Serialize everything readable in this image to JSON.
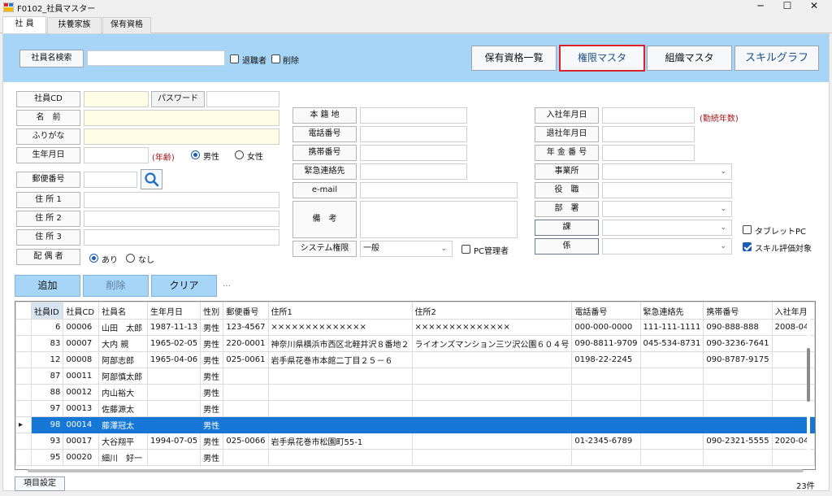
{
  "window": {
    "title": "F0102_社員マスター",
    "minimize": "─",
    "maximize": "☐",
    "close": "✕"
  },
  "tabs": [
    "社 員",
    "扶養家族",
    "保有資格"
  ],
  "search": {
    "button": "社員名検索",
    "value": "",
    "retired_label": "退職者",
    "deleted_label": "削除",
    "retired_checked": false,
    "deleted_checked": false
  },
  "top_buttons": {
    "qualifications": "保有資格一覧",
    "permission": "権限マスタ",
    "organization": "組織マスタ",
    "skill_graph": "スキルグラフ"
  },
  "form": {
    "employee_cd_label": "社員CD",
    "password_label": "パスワード",
    "name_label": "名　前",
    "furigana_label": "ふりがな",
    "birth_label": "生年月日",
    "age_text": "(年齢)",
    "gender": {
      "male": "男性",
      "female": "女性",
      "selected": "male"
    },
    "postal_label": "郵便番号",
    "address1_label": "住 所 1",
    "address2_label": "住 所 2",
    "address3_label": "住 所 3",
    "spouse_label": "配 偶 者",
    "spouse": {
      "yes": "あり",
      "no": "なし",
      "selected": "yes"
    },
    "domicile_label": "本 籍 地",
    "phone_label": "電話番号",
    "mobile_label": "携帯番号",
    "emergency_label": "緊急連絡先",
    "email_label": "e-mail",
    "notes_label": "備　考",
    "sys_perm_label": "システム権限",
    "sys_perm_value": "一般",
    "pc_admin_label": "PC管理者",
    "hire_label": "入社年月日",
    "tenure_text": "(勤続年数)",
    "retire_label": "退社年月日",
    "pension_label": "年 金 番 号",
    "office_label": "事業所",
    "position_label": "役　職",
    "dept_label": "部　署",
    "section_label": "課",
    "unit_label": "係",
    "tablet_label": "タブレットPC",
    "tablet_checked": false,
    "skill_label": "スキル評価対象",
    "skill_checked": true
  },
  "actions": {
    "add": "追加",
    "delete": "削除",
    "clear": "クリア",
    "more": "…"
  },
  "table": {
    "columns": [
      "社員ID",
      "社員CD",
      "社員名",
      "生年月日",
      "性別",
      "郵便番号",
      "住所1",
      "住所2",
      "電話番号",
      "緊急連絡先",
      "携帯番号",
      "入社年月"
    ],
    "rows": [
      [
        "6",
        "00006",
        "山田　太郎",
        "1987-11-13",
        "男性",
        "123-4567",
        "××××××××××××××",
        "××××××××××××××",
        "000-000-0000",
        "111-111-1111",
        "090-888-888",
        "2008-04"
      ],
      [
        "83",
        "00007",
        "大内 親",
        "1965-02-05",
        "男性",
        "220-0001",
        "神奈川県横浜市西区北軽井沢８番地２",
        "ライオンズマンション三ツ沢公園６０４号",
        "090-8811-9709",
        "045-534-8731",
        "090-3236-7641",
        ""
      ],
      [
        "12",
        "00008",
        "阿部志郎",
        "1965-04-06",
        "男性",
        "025-0061",
        "岩手県花巻市本館二丁目２５－６",
        "",
        "0198-22-2245",
        "",
        "090-8787-9175",
        ""
      ],
      [
        "87",
        "00011",
        "阿部慎太郎",
        "",
        "男性",
        "",
        "",
        "",
        "",
        "",
        "",
        ""
      ],
      [
        "88",
        "00012",
        "内山裕大",
        "",
        "男性",
        "",
        "",
        "",
        "",
        "",
        "",
        ""
      ],
      [
        "97",
        "00013",
        "佐藤源太",
        "",
        "男性",
        "",
        "",
        "",
        "",
        "",
        "",
        ""
      ],
      [
        "98",
        "00014",
        "藤澤冠太",
        "",
        "男性",
        "",
        "",
        "",
        "",
        "",
        "",
        ""
      ],
      [
        "93",
        "00017",
        "大谷翔平",
        "1994-07-05",
        "男性",
        "025-0066",
        "岩手県花巻市松園町55-1",
        "",
        "01-2345-6789",
        "",
        "090-2321-5555",
        "2020-04"
      ],
      [
        "95",
        "00020",
        "細川　好一",
        "",
        "男性",
        "",
        "",
        "",
        "",
        "",
        "",
        ""
      ]
    ],
    "selected_row": 6,
    "row_marker": "▸"
  },
  "footer": {
    "item_settings": "項目設定",
    "count": "23件"
  },
  "colors": {
    "band": "#a6d5f7",
    "selected_row": "#1677d6",
    "highlight_border": "#d8232a"
  }
}
